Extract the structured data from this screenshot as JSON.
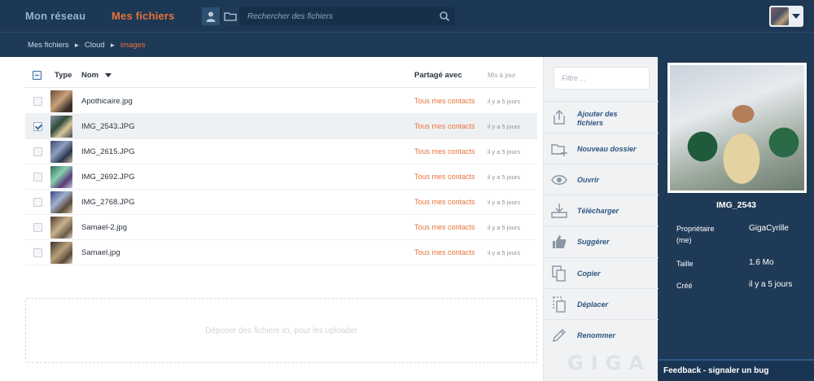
{
  "nav": {
    "reseau": "Mon réseau",
    "fichiers": "Mes fichiers"
  },
  "search": {
    "placeholder": "Rechercher des fichiers"
  },
  "breadcrumb": {
    "items": [
      "Mes fichiers",
      "Cloud"
    ],
    "current": "images",
    "separator": "►"
  },
  "table": {
    "headers": {
      "type": "Type",
      "nom": "Nom",
      "partage": "Partagé avec",
      "maj": "Mis à jour"
    },
    "rows": [
      {
        "name": "Apothicaire.jpg",
        "shared": "Tous mes contacts",
        "updated": "il y a 5 jours",
        "selected": false
      },
      {
        "name": "IMG_2543.JPG",
        "shared": "Tous mes contacts",
        "updated": "il y a 5 jours",
        "selected": true
      },
      {
        "name": "IMG_2615.JPG",
        "shared": "Tous mes contacts",
        "updated": "il y a 5 jours",
        "selected": false
      },
      {
        "name": "IMG_2692.JPG",
        "shared": "Tous mes contacts",
        "updated": "il y a 5 jours",
        "selected": false
      },
      {
        "name": "IMG_2768.JPG",
        "shared": "Tous mes contacts",
        "updated": "il y a 5 jours",
        "selected": false
      },
      {
        "name": "Samael-2.jpg",
        "shared": "Tous mes contacts",
        "updated": "il y a 5 jours",
        "selected": false
      },
      {
        "name": "Samael.jpg",
        "shared": "Tous mes contacts",
        "updated": "il y a 5 jours",
        "selected": false
      }
    ]
  },
  "dropzone": {
    "text": "Déposer des fichiers ici, pour les uploader"
  },
  "actions": {
    "filter_placeholder": "Filtre ...",
    "items": [
      {
        "label_1": "Ajouter des",
        "label_2": "fichiers",
        "icon": "upload-icon"
      },
      {
        "label_1": "Nouveau dossier",
        "label_2": "",
        "icon": "new-folder-icon"
      },
      {
        "label_1": "Ouvrir",
        "label_2": "",
        "icon": "eye-icon"
      },
      {
        "label_1": "Télécharger",
        "label_2": "",
        "icon": "download-icon"
      },
      {
        "label_1": "Suggérer",
        "label_2": "",
        "icon": "thumbs-up-icon"
      },
      {
        "label_1": "Copier",
        "label_2": "",
        "icon": "copy-icon"
      },
      {
        "label_1": "Déplacer",
        "label_2": "",
        "icon": "move-icon"
      },
      {
        "label_1": "Renommer",
        "label_2": "",
        "icon": "pencil-icon"
      }
    ],
    "logo": "GIGA"
  },
  "details": {
    "filename": "IMG_2543",
    "owner_label": "Propriétaire",
    "owner_label_2": "(me)",
    "owner_value": "GigaCyrille",
    "size_label": "Taille",
    "size_value": "1.6 Mo",
    "created_label": "Créé",
    "created_value": "il y a 5 jours"
  },
  "feedback": {
    "label": "Feedback - signaler un bug"
  },
  "colors": {
    "accent": "#e8723a",
    "navy": "#1f3a56",
    "link_blue": "#2f5680"
  }
}
